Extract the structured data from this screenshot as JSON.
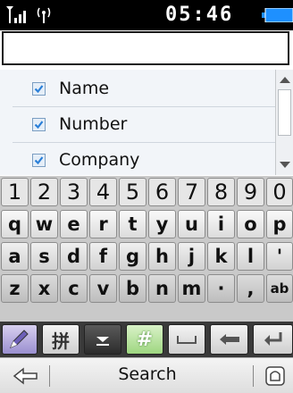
{
  "status": {
    "time": "05:46"
  },
  "search": {
    "value": "",
    "placeholder": ""
  },
  "list": {
    "items": [
      {
        "label": "Name",
        "checked": true
      },
      {
        "label": "Number",
        "checked": true
      },
      {
        "label": "Company",
        "checked": true
      }
    ]
  },
  "keyboard": {
    "numbers": [
      "1",
      "2",
      "3",
      "4",
      "5",
      "6",
      "7",
      "8",
      "9",
      "0"
    ],
    "row1": [
      "q",
      "w",
      "e",
      "r",
      "t",
      "y",
      "u",
      "i",
      "o",
      "p"
    ],
    "row2": [
      "a",
      "s",
      "d",
      "f",
      "g",
      "h",
      "j",
      "k",
      "l",
      "'"
    ],
    "row3": [
      "z",
      "x",
      "c",
      "v",
      "b",
      "n",
      "m",
      "·",
      ",",
      "ab"
    ],
    "toolbar": {
      "pinyin_label": "拼",
      "symbols_label": "#"
    }
  },
  "softkeys": {
    "center_label": "Search"
  },
  "colors": {
    "accent": "#1e90ff",
    "check": "#2a7fd8"
  },
  "icons": [
    "signal-icon",
    "antenna-icon",
    "battery-icon",
    "scroll-up-icon",
    "scroll-down-icon",
    "pen-icon",
    "hide-keyboard-icon",
    "space-icon",
    "backspace-icon",
    "enter-icon",
    "back-icon",
    "home-icon"
  ]
}
